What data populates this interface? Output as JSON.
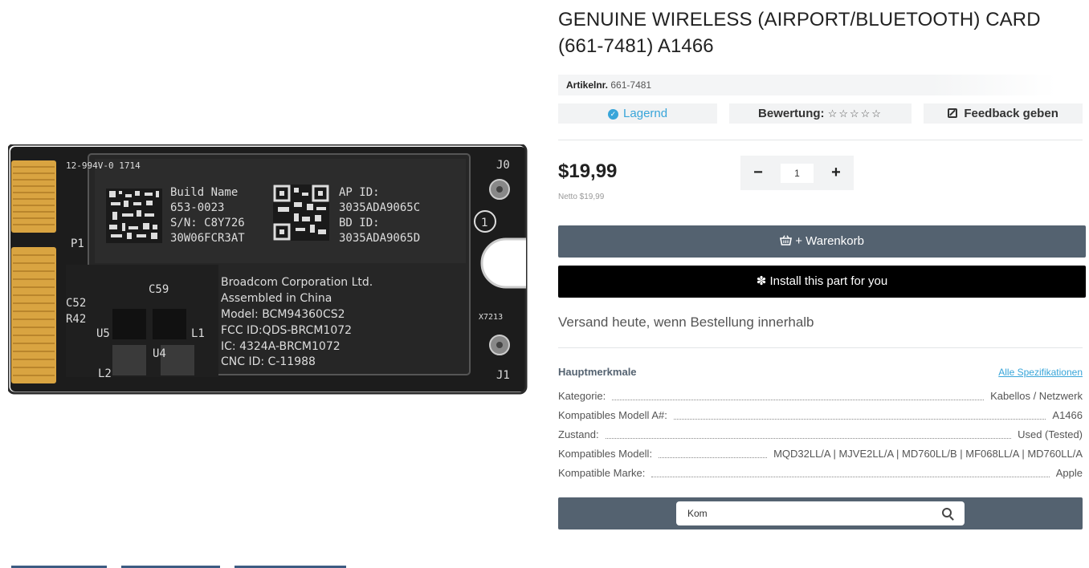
{
  "product": {
    "title": "GENUINE WIRELESS (AIRPORT/BLUETOOTH) CARD (661-7481) A1466",
    "sku_label": "Artikelnr.",
    "sku_value": "661-7481",
    "stock_label": "Lagernd",
    "rating_label": "Bewertung:",
    "rating_stars": "☆☆☆☆☆",
    "feedback_label": "Feedback geben",
    "price": "$19,99",
    "netto": "Netto $19,99",
    "quantity": "1",
    "qty_minus": "−",
    "qty_plus": "+",
    "cart_button": "+ Warenkorb",
    "install_button": "Install this part for you",
    "shipping_text": "Versand heute, wenn Bestellung innerhalb"
  },
  "card_image": {
    "build_name": "Build Name",
    "part_no": "653-0023",
    "serial": "S/N: C8Y726",
    "serial2": "30W06FCR3AT",
    "ap_id_label": "AP ID:",
    "ap_id": "3035ADA9065C",
    "bd_id_label": "BD ID:",
    "bd_id": "3035ADA9065D",
    "maker": "Broadcom Corporation Ltd.",
    "assembled": "Assembled in China",
    "model": "Model: BCM94360CS2",
    "fcc": "FCC ID:QDS-BRCM1072",
    "ic": "IC: 4324A-BRCM1072",
    "cnc": "CNC ID: C-11988",
    "side_code": "12-994V-0 1714",
    "p1": "P1",
    "c52": "C52",
    "r42": "R42",
    "u5": "U5",
    "l2": "L2",
    "c59": "C59",
    "u4": "U4",
    "l1": "L1",
    "j0": "J0",
    "j1": "J1",
    "one": "1",
    "x7": "X7213"
  },
  "specs": {
    "heading": "Hauptmerkmale",
    "all_link": "Alle Spezifikationen",
    "rows": [
      {
        "key": "Kategorie:",
        "value": "Kabellos / Netzwerk"
      },
      {
        "key": "Kompatibles Modell A#:",
        "value": "A1466"
      },
      {
        "key": "Zustand:",
        "value": "Used (Tested)"
      },
      {
        "key": "Kompatibles Modell:",
        "value": "MQD32LL/A | MJVE2LL/A | MD760LL/B | MF068LL/A | MD760LL/A"
      },
      {
        "key": "Kompatible Marke:",
        "value": "Apple"
      }
    ]
  },
  "search": {
    "value": "Kom"
  },
  "colors": {
    "accent": "#38a5d9",
    "button_gray": "#546270",
    "button_black": "#000000"
  }
}
